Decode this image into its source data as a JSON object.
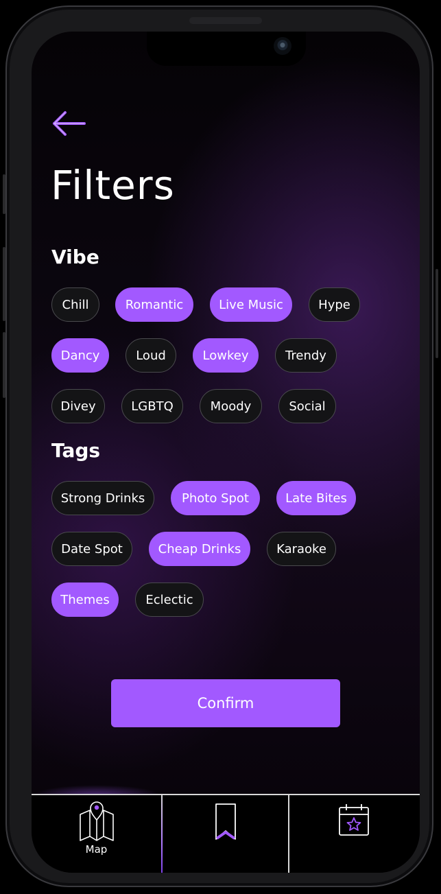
{
  "header": {
    "title": "Filters"
  },
  "vibe": {
    "heading": "Vibe",
    "rows": [
      [
        {
          "label": "Chill",
          "selected": false
        },
        {
          "label": "Romantic",
          "selected": true
        },
        {
          "label": "Live Music",
          "selected": true
        },
        {
          "label": "Hype",
          "selected": false
        }
      ],
      [
        {
          "label": "Dancy",
          "selected": true
        },
        {
          "label": "Loud",
          "selected": false
        },
        {
          "label": "Lowkey",
          "selected": true
        },
        {
          "label": "Trendy",
          "selected": false
        }
      ],
      [
        {
          "label": "Divey",
          "selected": false
        },
        {
          "label": "LGBTQ",
          "selected": false
        },
        {
          "label": "Moody",
          "selected": false
        },
        {
          "label": "Social",
          "selected": false
        }
      ]
    ]
  },
  "tags": {
    "heading": "Tags",
    "rows": [
      [
        {
          "label": "Strong Drinks",
          "selected": false
        },
        {
          "label": "Photo Spot",
          "selected": true
        },
        {
          "label": "Late Bites",
          "selected": true
        }
      ],
      [
        {
          "label": "Date Spot",
          "selected": false
        },
        {
          "label": "Cheap Drinks",
          "selected": true
        },
        {
          "label": "Karaoke",
          "selected": false
        }
      ],
      [
        {
          "label": "Themes",
          "selected": true
        },
        {
          "label": "Eclectic",
          "selected": false
        }
      ]
    ]
  },
  "confirm_label": "Confirm",
  "tab_bar": {
    "map_label": "Map",
    "icons": [
      "map-icon",
      "bookmark-icon",
      "calendar-star-icon"
    ]
  },
  "colors": {
    "accent": "#a259ff",
    "chip_bg": "#141416",
    "chip_border": "#4a4a4e",
    "text": "#ffffff"
  }
}
